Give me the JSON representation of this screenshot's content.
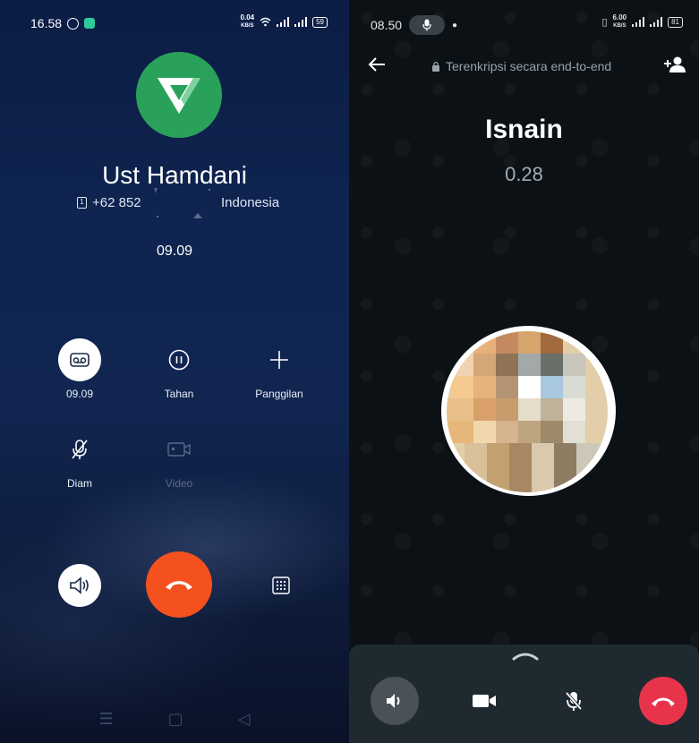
{
  "left_phone": {
    "status": {
      "time": "16.58",
      "network_speed": "0.04",
      "network_unit": "KB/S",
      "battery": "59"
    },
    "caller": {
      "name": "Ust Hamdani",
      "number": "+62 852",
      "country": "Indonesia",
      "timer": "09.09"
    },
    "controls": [
      {
        "label": "09.09",
        "icon": "record-icon"
      },
      {
        "label": "Tahan",
        "icon": "pause-icon"
      },
      {
        "label": "Panggilan",
        "icon": "add-call-icon"
      },
      {
        "label": "Diam",
        "icon": "mic-off-icon"
      },
      {
        "label": "Video",
        "icon": "video-icon"
      }
    ],
    "colors": {
      "end_call": "#f4511e",
      "logo_bg": "#2aa15a",
      "background": "#0f2450"
    }
  },
  "right_phone": {
    "status": {
      "time": "08.50",
      "network_speed": "6.00",
      "network_unit": "KB/S",
      "battery": "81"
    },
    "encryption_text": "Terenkripsi secara end-to-end",
    "contact_name": "Isnain",
    "call_timer": "0.28",
    "colors": {
      "end_call": "#e8344b",
      "background": "#0b1115",
      "panel": "#1f2a30"
    }
  }
}
